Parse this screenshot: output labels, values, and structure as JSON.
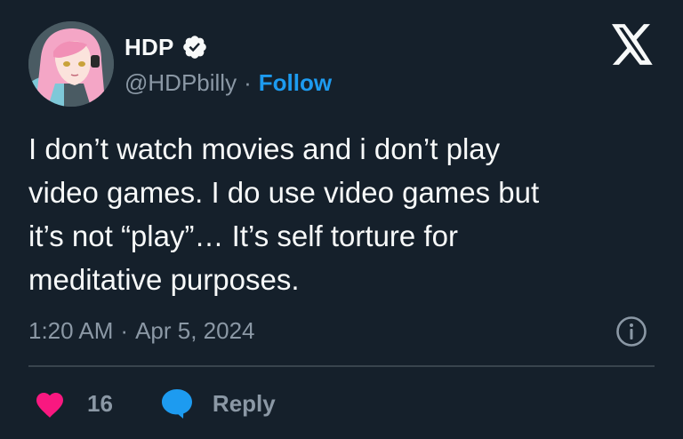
{
  "author": {
    "display_name": "HDP",
    "handle": "@HDPbilly",
    "separator": "·",
    "follow_label": "Follow",
    "verified": true,
    "avatar_icon": "anime-avatar-pink-hair"
  },
  "tweet": {
    "text": "I don’t watch movies and i don’t play\nvideo games. I do use video games but\nit’s not “play”… It’s self torture for\nmeditative purposes.",
    "time": "1:20 AM",
    "separator": "·",
    "date": "Apr 5, 2024"
  },
  "actions": {
    "like_count": "16",
    "reply_label": "Reply"
  },
  "icons": {
    "x_logo": "x-logo-icon",
    "info": "info-icon",
    "heart": "heart-icon",
    "reply": "reply-bubble-icon",
    "verified": "verified-badge-icon"
  },
  "colors": {
    "background": "#15202b",
    "text": "#f7f9f9",
    "muted": "#8b98a5",
    "accent": "#1d9bf0",
    "heart": "#f91880",
    "divider": "#38444d"
  }
}
